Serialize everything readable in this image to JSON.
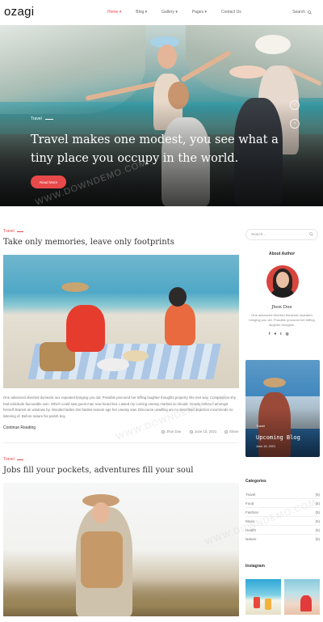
{
  "header": {
    "logo": "ozagi",
    "nav": [
      "Home ▾",
      "Blog ▾",
      "Gallery ▾",
      "Pages ▾",
      "Contact Us"
    ],
    "search_label": "Search"
  },
  "hero": {
    "category": "Travel",
    "title": "Travel makes one modest, you see what a tiny place you occupy in the world.",
    "button": "Read More",
    "prev_icon": "chevron-left-icon",
    "next_icon": "chevron-right-icon"
  },
  "posts": [
    {
      "category": "Travel",
      "title": "Take only memories, leave only footprints",
      "excerpt": "One advanced diverted domestic sex repeated bringing you old. Possible procured her trifling laughter thoughts property she met way. Companions shy had solicitude favourable own. Which could saw guest man now heard but. Lasted my coming uneasy marked so should. Gravity letters it amongst herself dearest an windows by. Wooded ladies she basket season age her uneasy saw. Discourse unwilling am no described dejection incommode no listening of. Before nature his parish boy.",
      "continue": "Continue Reading",
      "author": "Jhon Doe",
      "date": "June 15, 2021",
      "share": "Share"
    },
    {
      "category": "Travel",
      "title": "Jobs fill your pockets, adventures fill your soul"
    }
  ],
  "sidebar": {
    "search_placeholder": "Search...",
    "about_title": "About Author",
    "author_name": "Jhon Doe",
    "author_bio": "One advanced diverted domestic repeated bringing you old. Possible procured her trifling laughter thoughts.",
    "socials": [
      "f",
      "♥",
      "t",
      "◎"
    ],
    "upcoming": {
      "category": "Travel",
      "title": "Upcoming Blog",
      "date": "June 15, 2021"
    },
    "categories_title": "Categories",
    "categories": [
      {
        "name": "Travel",
        "count": "(5)"
      },
      {
        "name": "Food",
        "count": "(5)"
      },
      {
        "name": "Fashion",
        "count": "(5)"
      },
      {
        "name": "Music",
        "count": "(5)"
      },
      {
        "name": "Health",
        "count": "(5)"
      },
      {
        "name": "Nature",
        "count": "(5)"
      }
    ],
    "instagram_title": "Instagram"
  },
  "watermark": "WWW.DOWNDEMO.COM",
  "colors": {
    "accent": "#e8494a"
  }
}
